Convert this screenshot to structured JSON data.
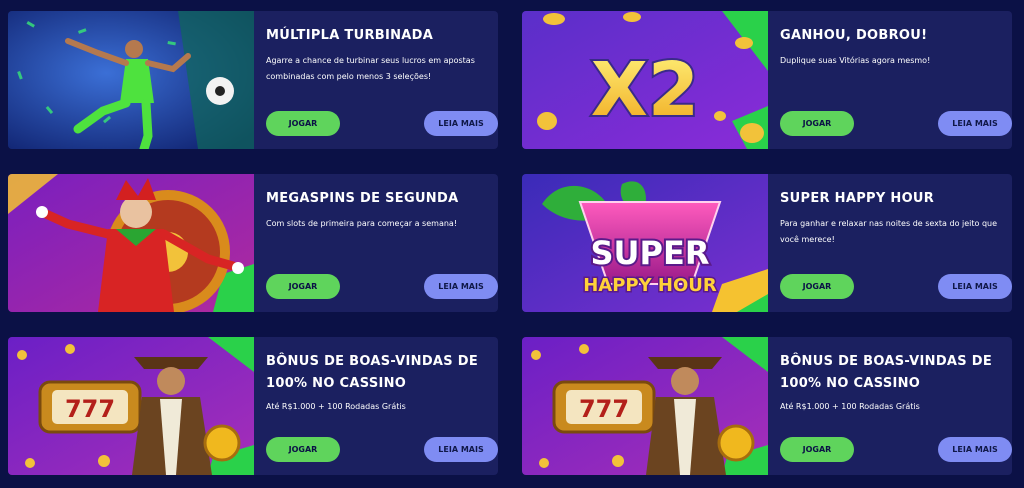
{
  "promotions": [
    {
      "title": "MÚLTIPLA TURBINADA",
      "description": "Agarre a chance de turbinar seus lucros em apostas combinadas com pelo menos 3 seleções!",
      "play_label": "JOGAR",
      "more_label": "LEIA MAIS",
      "image": "soccer-player"
    },
    {
      "title": "GANHOU, DOBROU!",
      "description": "Duplique suas Vitórias agora mesmo!",
      "play_label": "JOGAR",
      "more_label": "LEIA MAIS",
      "image": "x2-coins",
      "image_text": "X2"
    },
    {
      "title": "MEGASPINS DE SEGUNDA",
      "description": "Com slots de primeira para começar a semana!",
      "play_label": "JOGAR",
      "more_label": "LEIA MAIS",
      "image": "jester-wheel"
    },
    {
      "title": "SUPER HAPPY HOUR",
      "description": "Para ganhar e relaxar nas noites de sexta do jeito que você merece!",
      "play_label": "JOGAR",
      "more_label": "LEIA MAIS",
      "image": "cocktail",
      "image_text_1": "SUPER",
      "image_text_2": "HAPPY HOUR"
    },
    {
      "title": "BÔNUS DE BOAS-VINDAS DE 100% NO CASSINO",
      "description": "Até R$1.000 + 100 Rodadas Grátis",
      "play_label": "JOGAR",
      "more_label": "LEIA MAIS",
      "image": "adventurer-slot",
      "image_text": "777"
    },
    {
      "title": "BÔNUS DE BOAS-VINDAS DE 100% NO CASSINO",
      "description": "Até R$1.000 + 100 Rodadas Grátis",
      "play_label": "JOGAR",
      "more_label": "LEIA MAIS",
      "image": "adventurer-slot",
      "image_text": "777"
    }
  ],
  "colors": {
    "page_bg": "#0b1146",
    "card_bg": "#1b2060",
    "play_button": "#5fd45c",
    "more_button": "#7f8cf3"
  }
}
